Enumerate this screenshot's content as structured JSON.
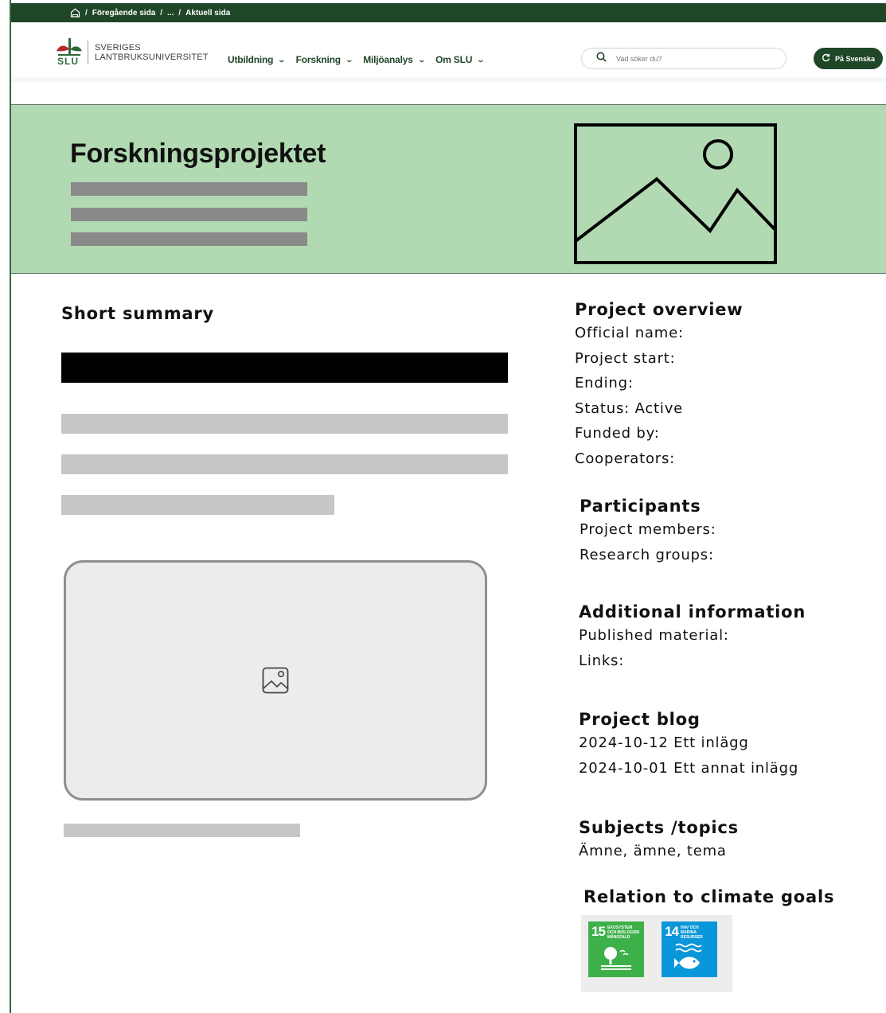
{
  "breadcrumb": {
    "previous": "Föregående sida",
    "ellipsis": "...",
    "current": "Aktuell sida",
    "separator": "/"
  },
  "header": {
    "logo_abbr": "SLU",
    "logo_line1": "SVERIGES",
    "logo_line2": "LANTBRUKSUNIVERSITET",
    "nav": [
      {
        "label": "Utbildning"
      },
      {
        "label": "Forskning"
      },
      {
        "label": "Miljöanalys"
      },
      {
        "label": "Om SLU"
      }
    ],
    "search_placeholder": "Vad söker du?",
    "language_button": "På Svenska"
  },
  "hero": {
    "title": "Forskningsprojektet"
  },
  "summary": {
    "title": "Short summary"
  },
  "overview": {
    "title": "Project overview",
    "items": [
      "Official name:",
      "Project start:",
      "Ending:",
      "Status: Active",
      "Funded by:",
      "Cooperators:"
    ]
  },
  "participants": {
    "title": "Participants",
    "items": [
      "Project members:",
      "Research groups:"
    ]
  },
  "additional": {
    "title": "Additional information",
    "items": [
      "Published material:",
      "Links:"
    ]
  },
  "blog": {
    "title": "Project blog",
    "items": [
      "2024-10-12 Ett inlägg",
      "2024-10-01 Ett annat inlägg"
    ]
  },
  "subjects": {
    "title": "Subjects /topics",
    "items": [
      "Ämne, ämne, tema"
    ]
  },
  "climate": {
    "title": "Relation to climate goals",
    "goals": [
      {
        "number": "15",
        "label": "EKOSYSTEM OCH BIOLOGISK MÅNGFALD",
        "color": "#3eb049"
      },
      {
        "number": "14",
        "label": "HAV OCH MARINA RESURSER",
        "color": "#0a97d9"
      }
    ]
  },
  "colors": {
    "brand_dark": "#1f4627",
    "hero_bg": "#b1d9b2"
  }
}
